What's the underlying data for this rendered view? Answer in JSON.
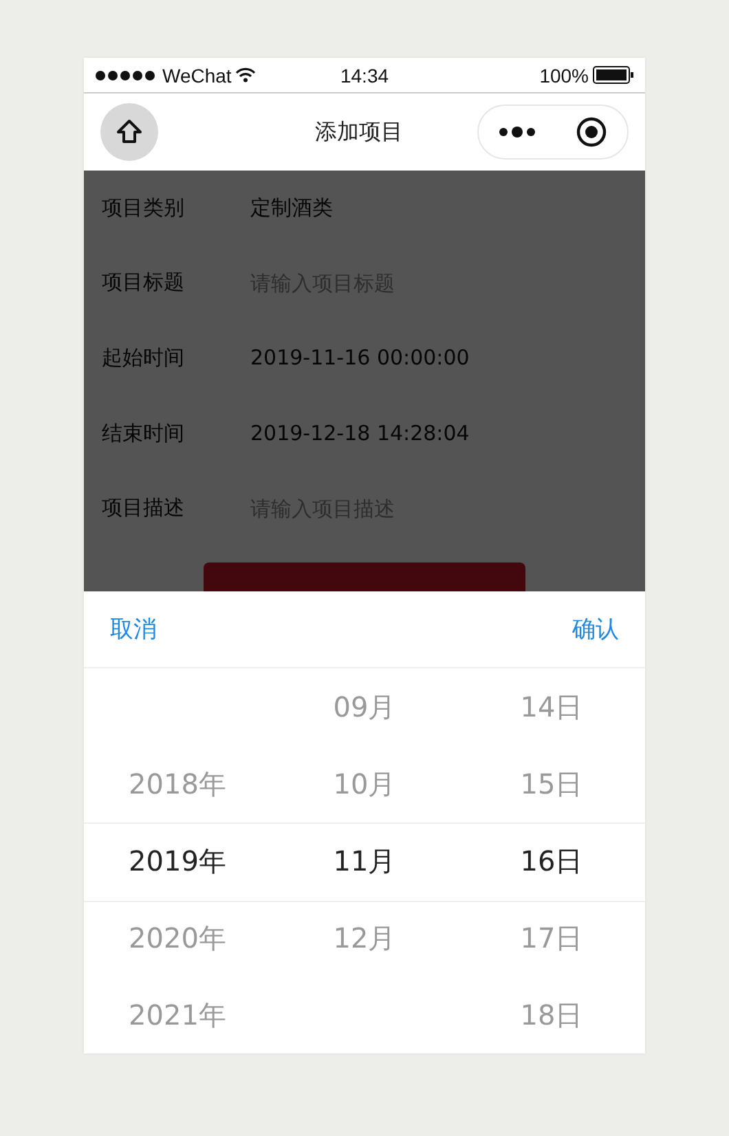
{
  "status_bar": {
    "carrier": "WeChat",
    "time": "14:34",
    "battery": "100%"
  },
  "nav": {
    "title": "添加项目"
  },
  "form": {
    "rows": [
      {
        "label": "项目类别",
        "value": "定制酒类"
      },
      {
        "label": "项目标题",
        "placeholder": "请输入项目标题"
      },
      {
        "label": "起始时间",
        "value": "2019-11-16 00:00:00"
      },
      {
        "label": "结束时间",
        "value": "2019-12-18 14:28:04"
      },
      {
        "label": "项目描述",
        "placeholder": "请输入项目描述"
      }
    ]
  },
  "picker": {
    "open": true,
    "cancel": "取消",
    "confirm": "确认",
    "columns": [
      {
        "items": [
          {
            "text": "2018年",
            "selected": false
          },
          {
            "text": "2019年",
            "selected": true
          },
          {
            "text": "2020年",
            "selected": false
          },
          {
            "text": "2021年",
            "selected": false
          }
        ]
      },
      {
        "items": [
          {
            "text": "09月",
            "selected": false
          },
          {
            "text": "10月",
            "selected": false
          },
          {
            "text": "11月",
            "selected": true
          },
          {
            "text": "12月",
            "selected": false
          }
        ]
      },
      {
        "items": [
          {
            "text": "14日",
            "selected": false
          },
          {
            "text": "15日",
            "selected": false
          },
          {
            "text": "16日",
            "selected": true
          },
          {
            "text": "17日",
            "selected": false
          },
          {
            "text": "18日",
            "selected": false
          }
        ]
      }
    ]
  }
}
